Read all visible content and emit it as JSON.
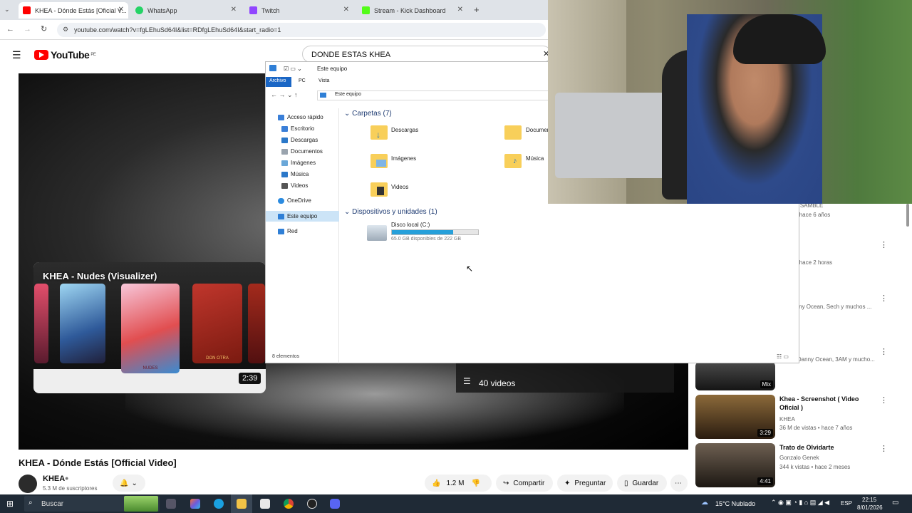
{
  "browser": {
    "tabs": [
      {
        "label": "KHEA - Dónde Estás [Oficial V...",
        "color": "#ff0000",
        "active": true
      },
      {
        "label": "WhatsApp",
        "color": "#25d366",
        "active": false
      },
      {
        "label": "Twitch",
        "color": "#9146ff",
        "active": false
      },
      {
        "label": "Stream - Kick Dashboard",
        "color": "#53fc18",
        "active": false
      }
    ],
    "new_tab": "+",
    "url": "youtube.com/watch?v=fgLEhuSd64I&list=RDfgLEhuSd64I&start_radio=1"
  },
  "youtube": {
    "logo": "YouTube",
    "region": "PE",
    "search_value": "DONDE ESTAS KHEA",
    "pip": {
      "title": "KHEA - Nudes (Visualizer)",
      "duration": "2:39",
      "card_label_1": "NUDES",
      "card_label_2": "DON OTRA"
    },
    "playlist_count": "40 videos",
    "video_title": "KHEA - Dónde Estás [Official Video]",
    "channel": {
      "name": "KHEA",
      "subscribers": "5.3 M de suscriptores"
    },
    "actions": {
      "likes": "1.2 M",
      "share": "Compartir",
      "ask": "Preguntar",
      "save": "Guardar"
    },
    "recommendations": [
      {
        "title": "",
        "meta1": "...S A N SAMBLE",
        "meta2": "vistas • hace 6 años"
      },
      {
        "title": "",
        "meta1": "arn",
        "meta2": "vistas • hace 2 horas"
      },
      {
        "title": "",
        "meta1": "ck, Danny Ocean, Sech y muchos ...",
        "meta2": ""
      },
      {
        "title": "p hop",
        "meta1": "ondra, Danny Ocean, 3AM y mucho...",
        "meta2": "",
        "badge": "Mix"
      },
      {
        "title": "Khea - Screenshot ( Video Oficial )",
        "meta1": "KHEA",
        "meta2": "36 M de vistas • hace 7 años",
        "duration": "3:29"
      },
      {
        "title": "Trato de Olvidarte",
        "meta1": "Gonzalo Genek",
        "meta2": "344 k vistas • hace 2 meses",
        "duration": "4:41"
      }
    ]
  },
  "explorer": {
    "title": "Este equipo",
    "ribbon": [
      "Archivo",
      "PC",
      "Vista"
    ],
    "breadcrumb": "Este equipo",
    "nav": [
      "Acceso rápido",
      "Escritorio",
      "Descargas",
      "Documentos",
      "Imágenes",
      "Música",
      "Videos",
      "OneDrive",
      "Este equipo",
      "Red"
    ],
    "folders_header": "Carpetas (7)",
    "folders": [
      "Descargas",
      "Documentos",
      "Imágenes",
      "Música",
      "Videos"
    ],
    "devices_header": "Dispositivos y unidades (1)",
    "drive": {
      "name": "Disco local (C:)",
      "free": "65.0 GB disponibles de 222 GB",
      "used_fraction": 0.71
    },
    "status": "8 elementos"
  },
  "taskbar": {
    "search": "Buscar",
    "weather": "15°C  Nublado",
    "lang": "ESP",
    "time": "22:15",
    "date": "8/01/2026"
  }
}
